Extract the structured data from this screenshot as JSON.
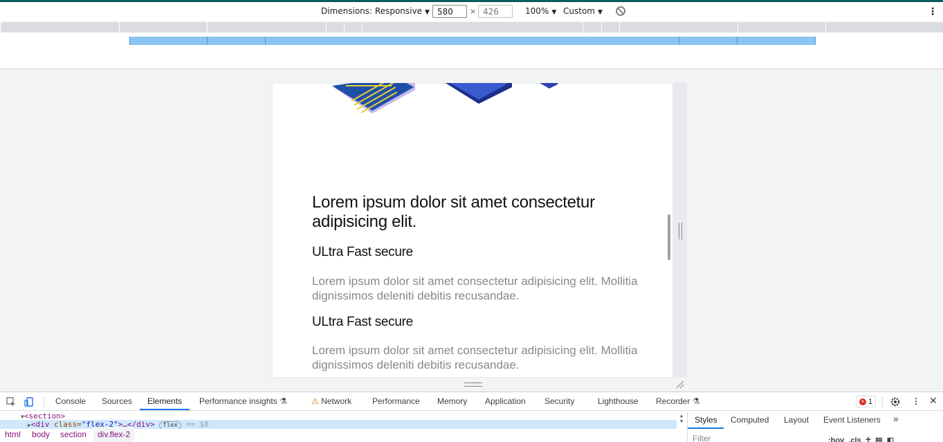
{
  "device_toolbar": {
    "dimensions_label": "Dimensions: Responsive",
    "width_value": "580",
    "height_placeholder": "426",
    "times": "×",
    "zoom": "100%",
    "throttle": "Custom"
  },
  "page": {
    "heading": "Lorem ipsum dolor sit amet consectetur adipisicing elit.",
    "features": [
      {
        "title": "ULtra Fast secure",
        "text": "Lorem ipsum dolor sit amet consectetur adipisicing elit. Mollitia dignissimos deleniti debitis recusandae."
      },
      {
        "title": "ULtra Fast secure",
        "text": "Lorem ipsum dolor sit amet consectetur adipisicing elit. Mollitia dignissimos deleniti debitis recusandae."
      }
    ]
  },
  "devtools": {
    "tabs": [
      "Console",
      "Sources",
      "Elements",
      "Performance insights",
      "Network",
      "Performance",
      "Memory",
      "Application",
      "Security",
      "Lighthouse",
      "Recorder"
    ],
    "active_tab": "Elements",
    "error_count": "1",
    "dom_line1": "<section>",
    "dom_line2_tag": "<div ",
    "dom_line2_attr": "class=",
    "dom_line2_val": "\"flex-2\"",
    "dom_line2_rest": ">…</div>",
    "dom_line2_badge": "flex",
    "dom_line2_ref": "== $0",
    "breadcrumbs": [
      "html",
      "body",
      "section",
      "div.flex-2"
    ],
    "sidebar_tabs": [
      "Styles",
      "Computed",
      "Layout",
      "Event Listeners"
    ],
    "sidebar_more": "»",
    "filter_placeholder": "Filter",
    "hov": ":hov",
    "cls": ".cls",
    "plus": "+"
  },
  "colors": {
    "accent": "#1a73e8",
    "mq_blue": "#8ac5f3",
    "error": "#d93025"
  }
}
